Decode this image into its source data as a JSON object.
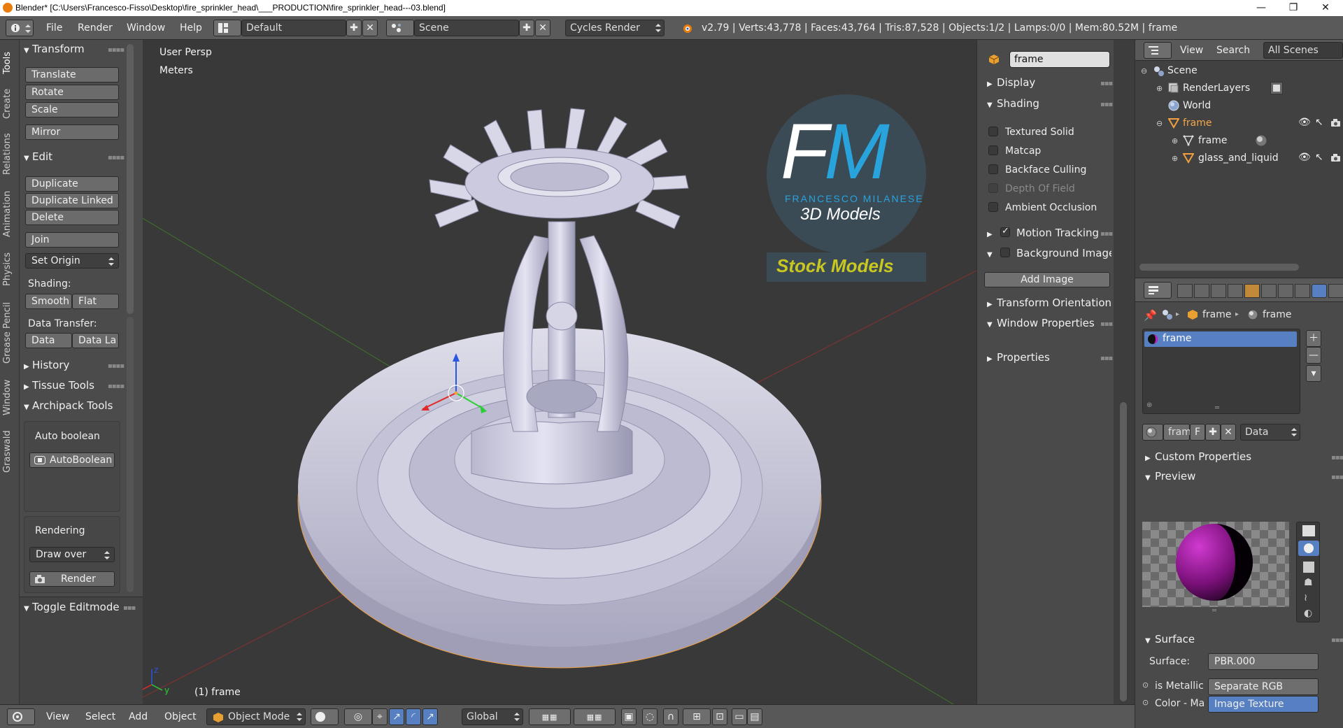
{
  "window": {
    "title": "Blender* [C:\\Users\\Francesco-Fisso\\Desktop\\fire_sprinkler_head\\___PRODUCTION\\fire_sprinkler_head---03.blend]",
    "minimize": "—",
    "maximize": "❐",
    "close": "✕"
  },
  "infobar": {
    "menus": [
      "File",
      "Render",
      "Window",
      "Help"
    ],
    "layout": "Default",
    "scene": "Scene",
    "engine": "Cycles Render",
    "stats": "v2.79 | Verts:43,778 | Faces:43,764 | Tris:87,528 | Objects:1/2 | Lamps:0/0 | Mem:80.52M | frame"
  },
  "tooltabs": [
    "Tools",
    "Create",
    "Relations",
    "Animation",
    "Physics",
    "Grease Pencil",
    "Window",
    "Graswald"
  ],
  "toolshelf": {
    "transform_header": "Transform",
    "translate": "Translate",
    "rotate": "Rotate",
    "scale": "Scale",
    "mirror": "Mirror",
    "edit_header": "Edit",
    "duplicate": "Duplicate",
    "duplicate_linked": "Duplicate Linked",
    "delete": "Delete",
    "join": "Join",
    "set_origin": "Set Origin",
    "shading_label": "Shading:",
    "smooth": "Smooth",
    "flat": "Flat",
    "data_transfer_label": "Data Transfer:",
    "data": "Data",
    "data_la": "Data La",
    "history": "History",
    "tissue_tools": "Tissue Tools",
    "archipack_tools": "Archipack Tools",
    "auto_boolean_label": "Auto boolean",
    "auto_boolean_btn": "AutoBoolean",
    "rendering_label": "Rendering",
    "draw_over": "Draw over",
    "render": "Render",
    "toggle_editmode": "Toggle Editmode"
  },
  "viewport": {
    "view_name": "User Persp",
    "units": "Meters",
    "object_label": "(1) frame",
    "logo_letters": "FM",
    "logo_name": "FRANCESCO MILANESE",
    "logo_sub": "3D Models",
    "stock": "Stock Models"
  },
  "npanel": {
    "object_name": "frame",
    "display": "Display",
    "shading": "Shading",
    "textured_solid": "Textured Solid",
    "matcap": "Matcap",
    "backface_culling": "Backface Culling",
    "depth_of_field": "Depth Of Field",
    "ambient_occlusion": "Ambient Occlusion",
    "motion_tracking": "Motion Tracking",
    "background_images": "Background Images",
    "add_image": "Add Image",
    "transform_orientations": "Transform Orientations",
    "window_properties": "Window Properties",
    "properties": "Properties"
  },
  "outliner": {
    "view": "View",
    "search": "Search",
    "all_scenes": "All Scenes",
    "items": [
      "Scene",
      "RenderLayers",
      "World",
      "frame",
      "frame",
      "glass_and_liquid"
    ]
  },
  "properties": {
    "crumb_obj": "frame",
    "crumb_mat": "frame",
    "slot": "frame",
    "mat_field": "frame",
    "mat_f": "F",
    "data": "Data",
    "custom_properties": "Custom Properties",
    "preview": "Preview",
    "surface_header": "Surface",
    "surface_label": "Surface:",
    "surface_value": "PBR.000",
    "metallic_label": "is Metallic",
    "metallic_value": "Separate RGB",
    "color_label": "Color - Ma",
    "color_value": "Image Texture"
  },
  "bottombar": {
    "view": "View",
    "select": "Select",
    "add": "Add",
    "object": "Object",
    "mode": "Object Mode",
    "orientation": "Global"
  },
  "colors": {
    "accent_blue": "#5680c2",
    "selection_orange": "#f0a040",
    "logo_blue": "#29a3dc",
    "logo_yellow": "#c8c820"
  }
}
